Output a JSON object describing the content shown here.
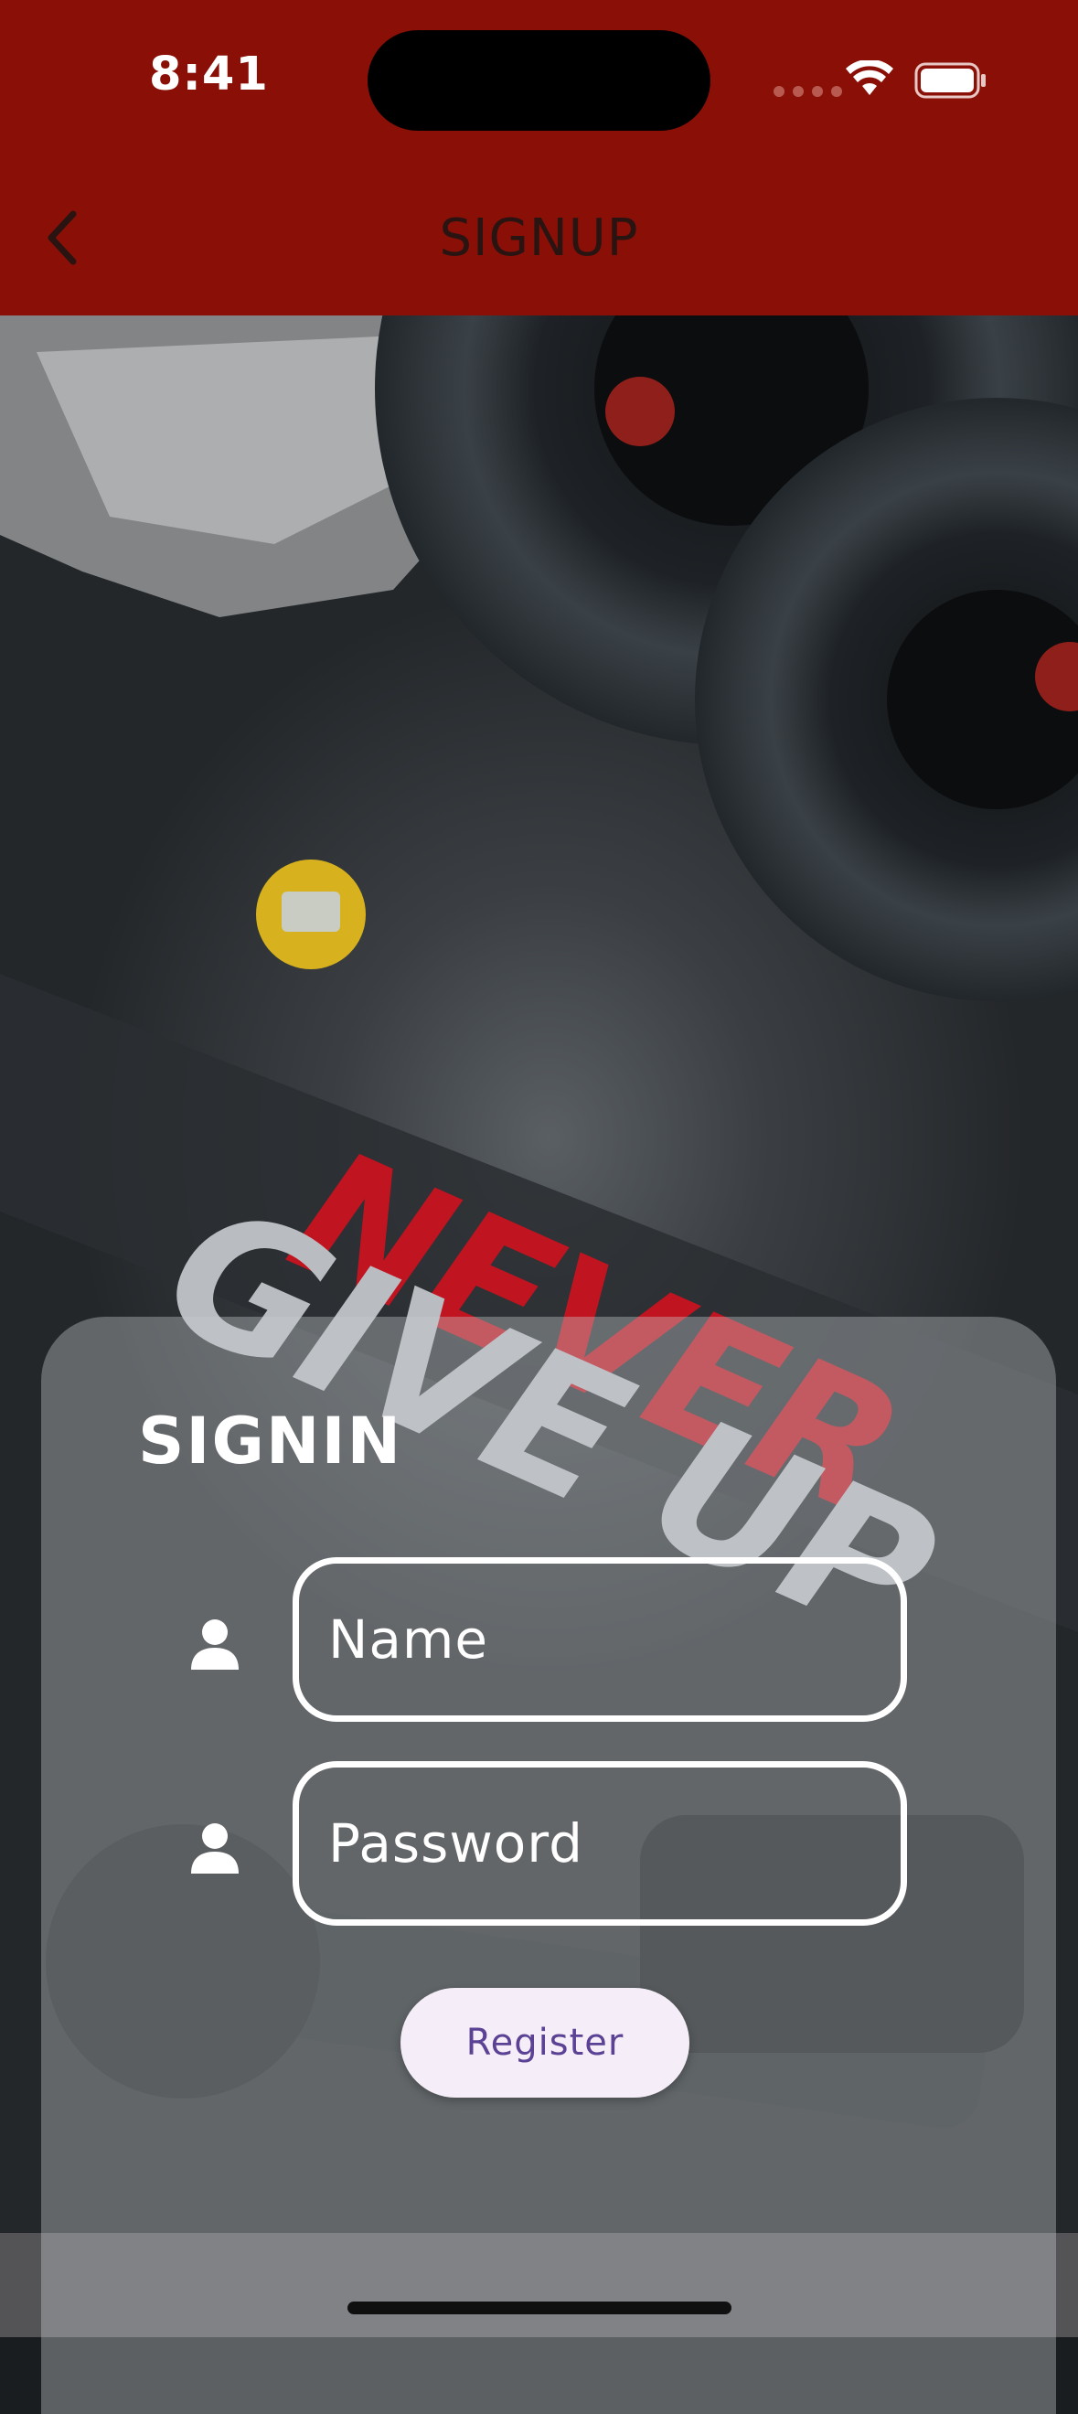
{
  "status_bar": {
    "time": "8:41",
    "icons": [
      "signal-dots-icon",
      "wifi-icon",
      "battery-icon"
    ]
  },
  "nav": {
    "back_icon": "chevron-left-icon",
    "title": "SIGNUP"
  },
  "background": {
    "slogan_line1": "NEVER",
    "slogan_line2": "GIVE UP"
  },
  "card": {
    "title": "SIGNIN",
    "fields": [
      {
        "icon": "person-icon",
        "placeholder": "Name"
      },
      {
        "icon": "person-icon",
        "placeholder": "Password"
      }
    ],
    "register_label": "Register"
  },
  "colors": {
    "header": "#8a1007",
    "button_bg": "#f5eef8",
    "button_text": "#5b4294",
    "slogan_red": "#c01420"
  }
}
